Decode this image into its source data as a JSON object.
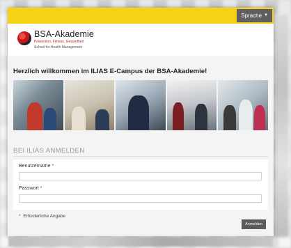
{
  "header": {
    "language_button": "Sprache",
    "language_caret_icon": "caret-down-icon",
    "bar_color": "#f7d117"
  },
  "logo": {
    "name": "BSA-Akademie",
    "tagline": "Prävention, Fitness, Gesundheit",
    "tagline2": "School for Health Management",
    "icon": "globe-logo-icon"
  },
  "welcome": "Herzlich willkommen im ILIAS E-Campus der BSA-Akademie!",
  "login": {
    "title": "BEI ILIAS ANMELDEN",
    "username_label": "Benutzername",
    "password_label": "Passwort",
    "required_marker": "*",
    "required_note": "Erforderliche Angabe",
    "submit_label": "Anmelden",
    "username_value": "",
    "password_value": ""
  },
  "colors": {
    "accent": "#f7d117",
    "button": "#5b5b5b",
    "required": "#c33311"
  }
}
